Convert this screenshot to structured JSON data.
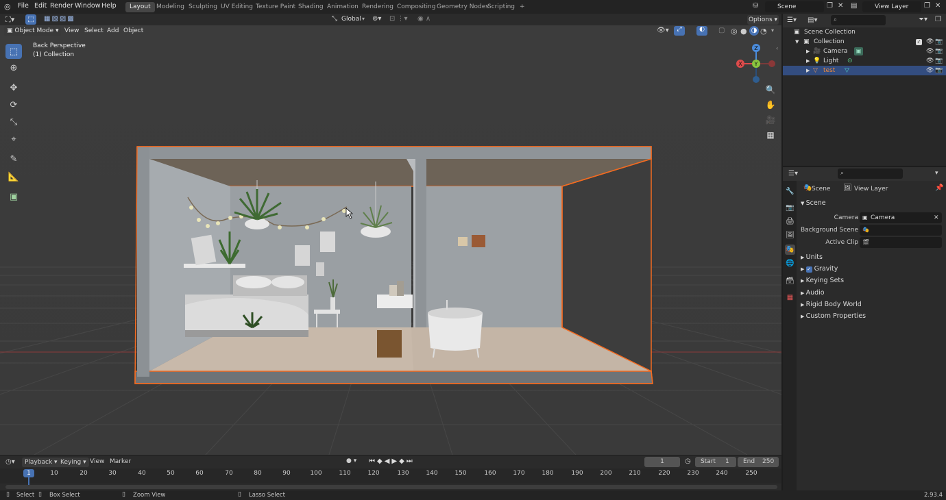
{
  "topbar": {
    "menus": [
      "File",
      "Edit",
      "Render",
      "Window",
      "Help"
    ],
    "workspaces": [
      "Layout",
      "Modeling",
      "Sculpting",
      "UV Editing",
      "Texture Paint",
      "Shading",
      "Animation",
      "Rendering",
      "Compositing",
      "Geometry Nodes",
      "Scripting"
    ],
    "active_workspace": "Layout",
    "add_tab": "+",
    "scene_field": "Scene",
    "view_layer_field": "View Layer"
  },
  "viewport": {
    "mode": "Object Mode",
    "menus": [
      "View",
      "Select",
      "Add",
      "Object"
    ],
    "orientation": "Global",
    "options_label": "Options",
    "overlay_title": "Back Perspective",
    "overlay_subtitle": "(1) Collection",
    "gizmo_labels": {
      "x": "X",
      "y": "Y",
      "z": "Z"
    },
    "selection_outline_color": "#f26b21",
    "grid_red_axis_color": "#8c3a3a"
  },
  "outliner": {
    "title": "Scene Collection",
    "rows": [
      {
        "label": "Collection",
        "indent": 1
      },
      {
        "label": "Camera",
        "indent": 2
      },
      {
        "label": "Light",
        "indent": 2
      },
      {
        "label": "test",
        "indent": 2,
        "selected": true
      }
    ]
  },
  "properties": {
    "breadcrumb_scene": "Scene",
    "breadcrumb_view_layer": "View Layer",
    "section_title": "Scene",
    "camera_label": "Camera",
    "camera_value": "Camera",
    "background_scene_label": "Background Scene",
    "active_clip_label": "Active Clip",
    "subsections": [
      "Units",
      "Gravity",
      "Keying Sets",
      "Audio",
      "Rigid Body World",
      "Custom Properties"
    ],
    "gravity_checked": true
  },
  "timeline": {
    "menus": [
      "Playback",
      "Keying",
      "View",
      "Marker"
    ],
    "current_frame": "1",
    "start_label": "Start",
    "start_value": "1",
    "end_label": "End",
    "end_value": "250",
    "ruler": [
      "10",
      "20",
      "30",
      "40",
      "50",
      "60",
      "70",
      "80",
      "90",
      "100",
      "110",
      "120",
      "130",
      "140",
      "150",
      "160",
      "170",
      "180",
      "190",
      "200",
      "210",
      "220",
      "230",
      "240",
      "250"
    ],
    "playhead_label": "1"
  },
  "statusbar": {
    "select": "Select",
    "box_select": "Box Select",
    "zoom_view": "Zoom View",
    "lasso_select": "Lasso Select",
    "version": "2.93.4"
  }
}
